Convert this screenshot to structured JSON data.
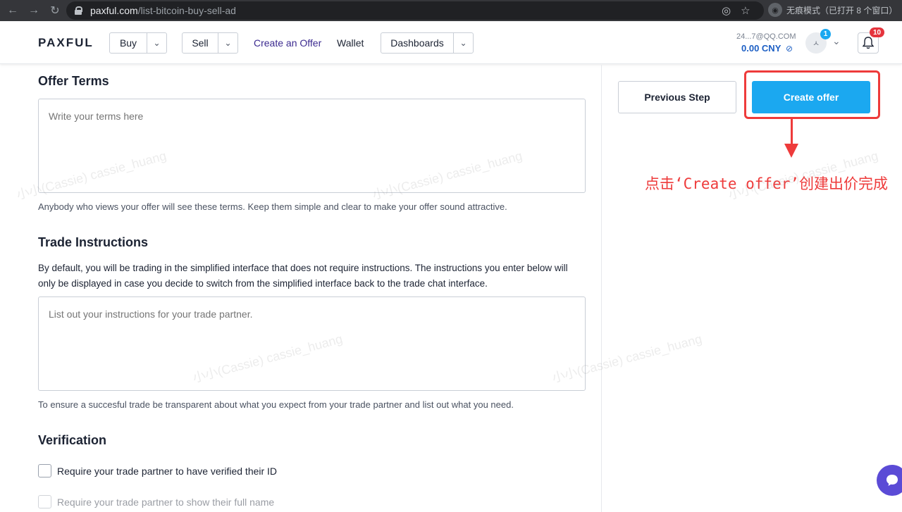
{
  "browser": {
    "url_host": "paxful.com",
    "url_path": "/list-bitcoin-buy-sell-ad",
    "incognito_label": "无痕模式（已打开 8 个窗口）"
  },
  "header": {
    "logo": "PAXFUL",
    "nav": {
      "buy": "Buy",
      "sell": "Sell",
      "create_offer": "Create an Offer",
      "wallet": "Wallet",
      "dashboards": "Dashboards"
    },
    "account": {
      "email": "24...7@QQ.COM",
      "balance": "0.00 CNY",
      "avatar_badge": "1",
      "notifications_badge": "10"
    }
  },
  "offer_terms": {
    "title": "Offer Terms",
    "placeholder": "Write your terms here",
    "help": "Anybody who views your offer will see these terms. Keep them simple and clear to make your offer sound attractive."
  },
  "trade_instructions": {
    "title": "Trade Instructions",
    "description": "By default, you will be trading in the simplified interface that does not require instructions. The instructions you enter below will only be displayed in case you decide to switch from the simplified interface back to the trade chat interface.",
    "placeholder": "List out your instructions for your trade partner.",
    "help": "To ensure a succesful trade be transparent about what you expect from your trade partner and list out what you need."
  },
  "verification": {
    "title": "Verification",
    "options": [
      "Require your trade partner to have verified their ID",
      "Require your trade partner to show their full name"
    ]
  },
  "actions": {
    "previous": "Previous Step",
    "create": "Create offer"
  },
  "annotation": {
    "text": "点击‘Create offer’创建出价完成",
    "color": "#ee3b3b"
  },
  "watermark": "小小(Cassie) cassie_huang",
  "colors": {
    "primary": "#1ba8f0",
    "link": "#3b2a8f",
    "balance": "#1d5fc4",
    "badge_blue": "#1ba8f0",
    "badge_red": "#e5343d"
  }
}
